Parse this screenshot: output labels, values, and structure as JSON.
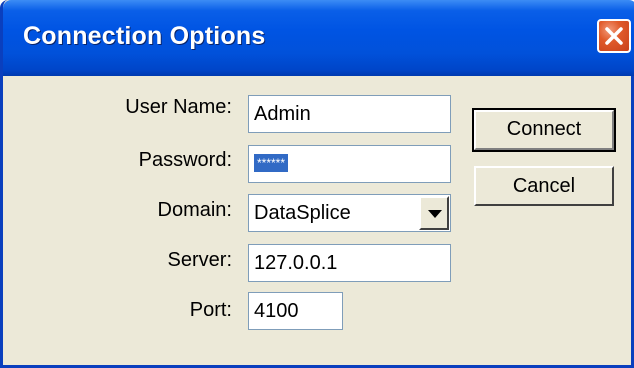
{
  "window": {
    "title": "Connection Options"
  },
  "form": {
    "username_label": "User Name:",
    "username_value": "Admin",
    "password_label": "Password:",
    "password_masked": "******",
    "domain_label": "Domain:",
    "domain_value": "DataSplice",
    "server_label": "Server:",
    "server_value": "127.0.0.1",
    "port_label": "Port:",
    "port_value": "4100"
  },
  "buttons": {
    "connect_label": "Connect",
    "cancel_label": "Cancel"
  },
  "icons": {
    "close": "close-icon",
    "dropdown": "chevron-down-icon"
  },
  "colors": {
    "titlebar": "#0054E3",
    "window_bg": "#ECE9D8",
    "selection": "#316AC5",
    "close_button": "#E05A2A"
  }
}
